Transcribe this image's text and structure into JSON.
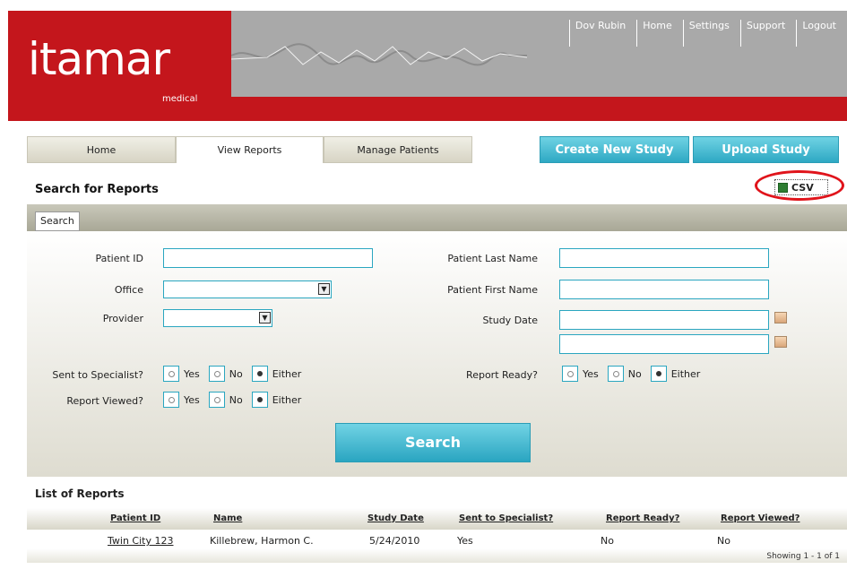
{
  "brand": {
    "logo": "itamar",
    "logo_sub": "medical"
  },
  "topnav": [
    "Dov Rubin",
    "Home",
    "Settings",
    "Support",
    "Logout"
  ],
  "tabs": [
    "Home",
    "View Reports",
    "Manage Patients"
  ],
  "actions": {
    "create": "Create New Study",
    "upload": "Upload Study"
  },
  "panel": {
    "title": "Search for Reports",
    "csv": "CSV",
    "search_tab": "Search"
  },
  "form": {
    "patient_id": "Patient ID",
    "office": "Office",
    "provider": "Provider",
    "last_name": "Patient Last Name",
    "first_name": "Patient First Name",
    "study_date": "Study Date",
    "sent_specialist": "Sent to Specialist?",
    "report_viewed": "Report Viewed?",
    "report_ready": "Report Ready?",
    "opt_yes": "Yes",
    "opt_no": "No",
    "opt_either": "Either",
    "search_button": "Search"
  },
  "list": {
    "title": "List of Reports",
    "columns": [
      "Patient ID",
      "Name",
      "Study Date",
      "Sent to Specialist?",
      "Report Ready?",
      "Report Viewed?"
    ],
    "rows": [
      [
        "Twin City 123",
        "Killebrew, Harmon C.",
        "5/24/2010",
        "Yes",
        "No",
        "No"
      ]
    ],
    "showing": "Showing 1 - 1 of 1"
  },
  "colors": {
    "brand_red": "#c4161c",
    "accent_cyan": "#2ea8c3"
  }
}
